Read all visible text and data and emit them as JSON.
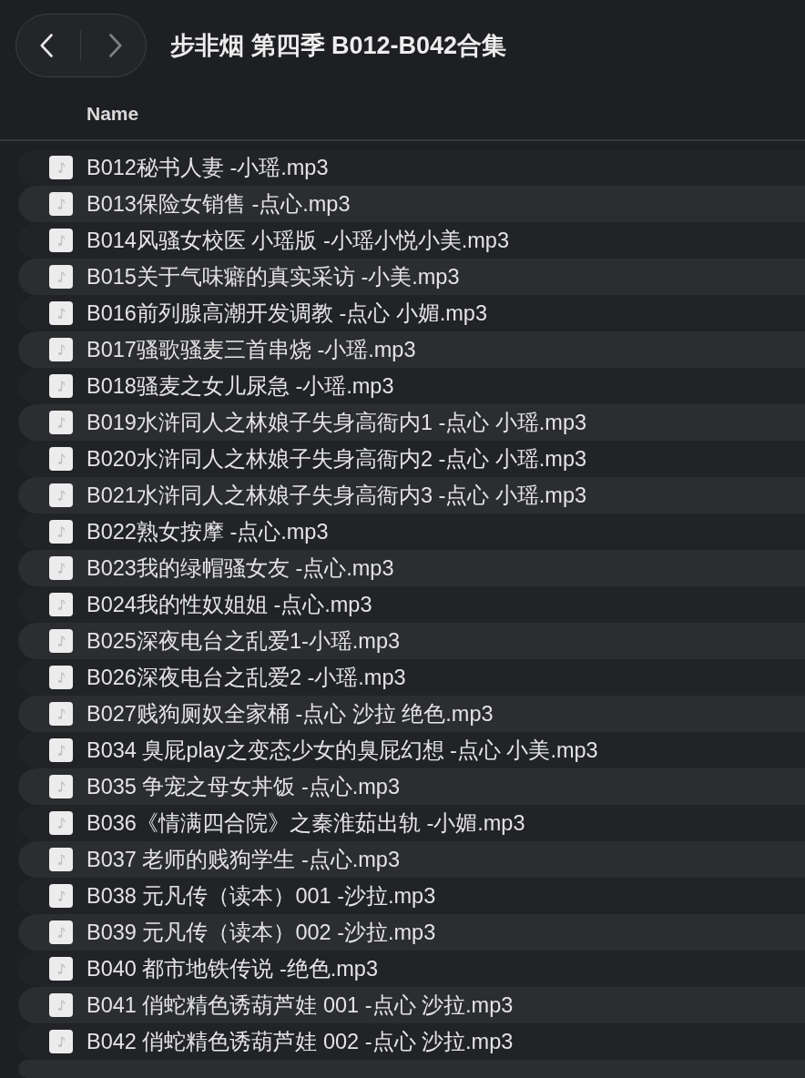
{
  "window": {
    "title": "步非烟 第四季 B012-B042合集"
  },
  "navigation": [
    {
      "kind": "back",
      "disabled": false
    },
    {
      "kind": "forward",
      "disabled": true
    }
  ],
  "columns": [
    {
      "label": "Name"
    }
  ],
  "files": [
    {
      "name": "B012秘书人妻 -小瑶.mp3"
    },
    {
      "name": "B013保险女销售 -点心.mp3"
    },
    {
      "name": "B014风骚女校医 小瑶版 -小瑶小悦小美.mp3"
    },
    {
      "name": "B015关于气味癖的真实采访 -小美.mp3"
    },
    {
      "name": "B016前列腺高潮开发调教 -点心 小媚.mp3"
    },
    {
      "name": "B017骚歌骚麦三首串烧 -小瑶.mp3"
    },
    {
      "name": "B018骚麦之女儿尿急 -小瑶.mp3"
    },
    {
      "name": "B019水浒同人之林娘子失身高衙内1 -点心 小瑶.mp3"
    },
    {
      "name": "B020水浒同人之林娘子失身高衙内2 -点心 小瑶.mp3"
    },
    {
      "name": "B021水浒同人之林娘子失身高衙内3 -点心 小瑶.mp3"
    },
    {
      "name": "B022熟女按摩 -点心.mp3"
    },
    {
      "name": "B023我的绿帽骚女友 -点心.mp3"
    },
    {
      "name": "B024我的性奴姐姐 -点心.mp3"
    },
    {
      "name": "B025深夜电台之乱爱1-小瑶.mp3"
    },
    {
      "name": "B026深夜电台之乱爱2 -小瑶.mp3"
    },
    {
      "name": "B027贱狗厕奴全家桶 -点心 沙拉 绝色.mp3"
    },
    {
      "name": "B034 臭屁play之变态少女的臭屁幻想 -点心 小美.mp3"
    },
    {
      "name": "B035 争宠之母女丼饭 -点心.mp3"
    },
    {
      "name": "B036《情满四合院》之秦淮茹出轨 -小媚.mp3"
    },
    {
      "name": "B037 老师的贱狗学生 -点心.mp3"
    },
    {
      "name": "B038 元凡传（读本）001 -沙拉.mp3"
    },
    {
      "name": "B039 元凡传（读本）002 -沙拉.mp3"
    },
    {
      "name": "B040 都市地铁传说 -绝色.mp3"
    },
    {
      "name": "B041 俏蛇精色诱葫芦娃 001 -点心 沙拉.mp3"
    },
    {
      "name": "B042 俏蛇精色诱葫芦娃 002 -点心 沙拉.mp3"
    }
  ]
}
